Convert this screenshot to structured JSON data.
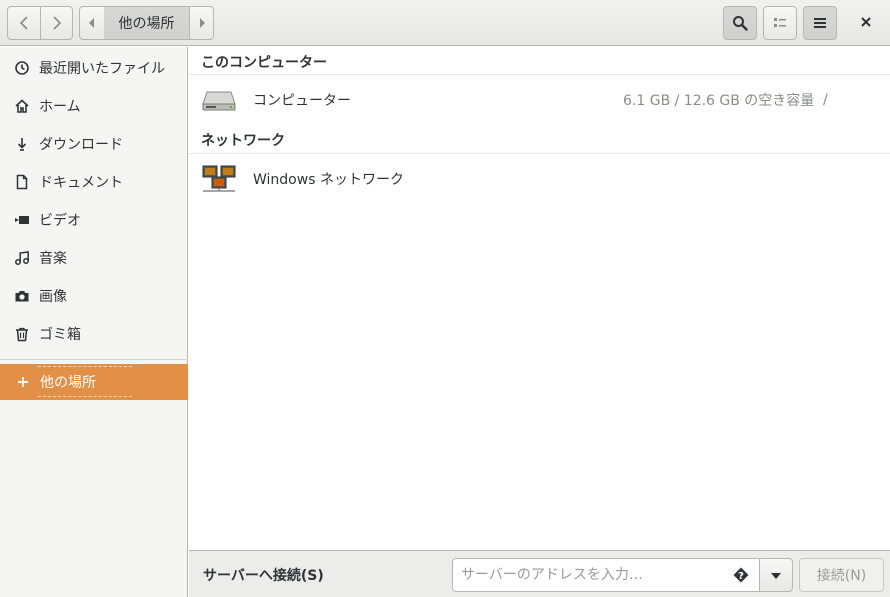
{
  "header": {
    "path_label": "他の場所",
    "icons": {
      "back": "chevron-left-icon",
      "forward": "chevron-right-icon",
      "path_prev": "triangle-left-icon",
      "path_next": "triangle-right-icon",
      "search": "search-icon",
      "view": "list-view-icon",
      "menu": "hamburger-menu-icon",
      "close": "close-icon"
    }
  },
  "sidebar": {
    "items": [
      {
        "label": "最近開いたファイル",
        "icon": "clock-icon"
      },
      {
        "label": "ホーム",
        "icon": "home-icon"
      },
      {
        "label": "ダウンロード",
        "icon": "download-icon"
      },
      {
        "label": "ドキュメント",
        "icon": "document-icon"
      },
      {
        "label": "ビデオ",
        "icon": "video-icon"
      },
      {
        "label": "音楽",
        "icon": "music-icon"
      },
      {
        "label": "画像",
        "icon": "camera-icon"
      },
      {
        "label": "ゴミ箱",
        "icon": "trash-icon"
      }
    ],
    "other_locations": {
      "label": "他の場所",
      "icon": "plus-icon",
      "selected": true
    }
  },
  "main": {
    "sections": [
      {
        "title": "このコンピューター",
        "rows": [
          {
            "label": "コンピューター",
            "info": "6.1 GB / 12.6 GB の空き容量",
            "path": "/",
            "icon": "harddisk-icon"
          }
        ]
      },
      {
        "title": "ネットワーク",
        "rows": [
          {
            "label": "Windows ネットワーク",
            "info": "",
            "path": "",
            "icon": "network-computers-icon"
          }
        ]
      }
    ]
  },
  "actionbar": {
    "title": "サーバーへ接続(S)",
    "server_placeholder": "サーバーのアドレスを入力…",
    "server_value": "",
    "connect_label": "接続(N)",
    "help_icon": "help-icon",
    "dropdown_icon": "dropdown-arrow-icon"
  },
  "colors": {
    "accent": "#e28f47",
    "sidebar_bg": "#f5f5f4",
    "header_bg": "#e8e8e7",
    "text": "#2e3436",
    "muted_text": "#8a8d88"
  }
}
